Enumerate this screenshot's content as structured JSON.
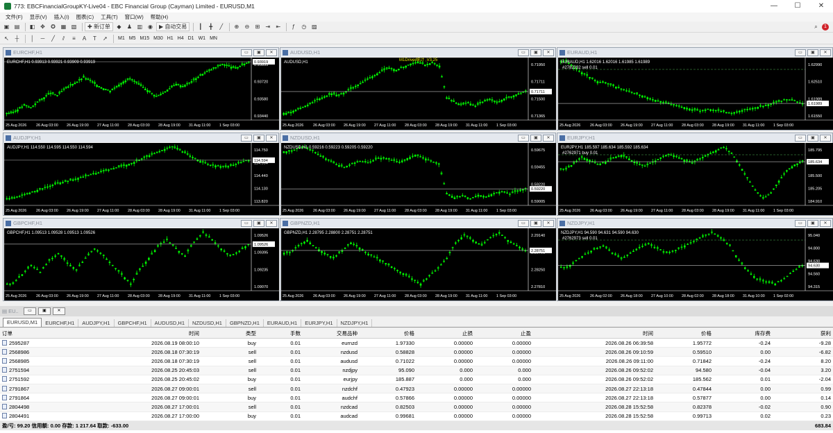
{
  "window": {
    "title": "773: EBCFinancialGroupKY-Live04 - EBC Financial Group (Cayman) Limited - EURUSD,M1",
    "controls": [
      "—",
      "☐",
      "✕"
    ]
  },
  "menu": [
    "文件(F)",
    "显示(V)",
    "插入(I)",
    "图表(C)",
    "工具(T)",
    "窗口(W)",
    "帮助(H)"
  ],
  "toolbar": {
    "new_order": "新订单",
    "auto_trading": "自动交易",
    "timeframes": [
      "M1",
      "M5",
      "M15",
      "M30",
      "H1",
      "H4",
      "D1",
      "W1",
      "MN"
    ],
    "notification_count": "1"
  },
  "colors": {
    "chart_bg": "#000000",
    "bull_candle": "#00ff00",
    "price_line": "#c0c0c0",
    "order_line": "#4caf50"
  },
  "charts": [
    {
      "id": "eurchf",
      "window_title": "EURCHF,H1",
      "header": "EURCHF,H1  0.93913 0.93921 0.93909 0.93919",
      "price_ticks": [
        "0.93855",
        "0.93720",
        "0.93580",
        "0.93440"
      ],
      "current_price": "0.93919",
      "x_ticks": [
        "25 Aug 2026",
        "26 Aug 03:00",
        "26 Aug 19:00",
        "27 Aug 11:00",
        "28 Aug 03:00",
        "28 Aug 19:00",
        "31 Aug 11:00",
        "1 Sep 03:00"
      ],
      "series": [
        0.9346,
        0.9349,
        0.9353,
        0.9351,
        0.9356,
        0.936,
        0.9364,
        0.9362,
        0.9367,
        0.9371,
        0.9374,
        0.9378,
        0.9375,
        0.9371,
        0.9368,
        0.9366,
        0.937,
        0.9374,
        0.9377,
        0.9373,
        0.9369,
        0.9365,
        0.9361,
        0.9364,
        0.9368,
        0.9372,
        0.937,
        0.9373,
        0.9377,
        0.9381,
        0.9384,
        0.9387,
        0.939,
        0.9388,
        0.9386,
        0.9389,
        0.9392
      ],
      "labels": []
    },
    {
      "id": "audusd",
      "window_title": "AUDUSD,H1",
      "header": "AUDUSD,H1",
      "price_ticks": [
        "0.71950",
        "0.71711",
        "0.71500",
        "0.71365"
      ],
      "current_price": "0.71711",
      "x_ticks": [
        "25 Aug 2026",
        "26 Aug 03:00",
        "26 Aug 19:00",
        "27 Aug 11:00",
        "28 Aug 03:00",
        "28 Aug 19:00",
        "31 Aug 11:00",
        "1 Sep 03:00"
      ],
      "series": [
        0.7147,
        0.715,
        0.7153,
        0.7156,
        0.716,
        0.7163,
        0.7166,
        0.7164,
        0.7168,
        0.7172,
        0.7176,
        0.718,
        0.7184,
        0.7188,
        0.7191,
        0.7189,
        0.7192,
        0.7195,
        0.7197,
        0.7194,
        0.7196,
        0.7193,
        0.7162,
        0.7158,
        0.7155,
        0.7157,
        0.7154,
        0.7158,
        0.716,
        0.7157,
        0.7161,
        0.7163,
        0.7166,
        0.7168
      ],
      "labels": [
        "M1Driver统计 ,V3.25"
      ]
    },
    {
      "id": "euraud",
      "window_title": "EURAUD,H1",
      "header": "EURAUD,H1  1.62016 1.62016 1.61985 1.61989",
      "price_ticks": [
        "1.62990",
        "1.62510",
        "1.61989",
        "1.61550"
      ],
      "current_price": "1.61989",
      "x_ticks": [
        "25 Aug 2026",
        "26 Aug 03:00",
        "26 Aug 19:00",
        "27 Aug 11:00",
        "28 Aug 03:00",
        "28 Aug 19:00",
        "31 Aug 11:00",
        "1 Sep 03:00"
      ],
      "series": [
        1.6315,
        1.6298,
        1.6285,
        1.6272,
        1.626,
        1.6255,
        1.6248,
        1.624,
        1.6232,
        1.6225,
        1.6218,
        1.621,
        1.6205,
        1.6198,
        1.6192,
        1.6188,
        1.6182,
        1.6178,
        1.6183,
        1.618,
        1.6176,
        1.6172,
        1.6178,
        1.6183,
        1.6187,
        1.6192,
        1.6198,
        1.6204,
        1.621,
        1.6206,
        1.6199
      ],
      "labels": [
        "#2782332 sell 0.01"
      ]
    },
    {
      "id": "audjpy",
      "window_title": "AUDJPY,H1",
      "header": "AUDJPY,H1  114.550 114.595 114.550 114.594",
      "price_ticks": [
        "114.750",
        "114.594",
        "114.440",
        "114.130",
        "113.820"
      ],
      "current_price": "114.594",
      "x_ticks": [
        "25 Aug 2026",
        "26 Aug 03:00",
        "26 Aug 19:00",
        "27 Aug 11:00",
        "28 Aug 03:00",
        "28 Aug 19:00",
        "31 Aug 11:00",
        "1 Sep 03:00"
      ],
      "series": [
        113.86,
        113.9,
        113.95,
        114.0,
        114.05,
        114.1,
        114.15,
        114.18,
        114.22,
        114.26,
        114.3,
        114.34,
        114.38,
        114.42,
        114.46,
        114.5,
        114.55,
        114.62,
        114.68,
        114.74,
        114.8,
        114.84,
        114.78,
        114.7,
        114.62,
        114.55,
        114.5,
        114.48,
        114.46,
        114.5,
        114.55,
        114.59
      ],
      "labels": []
    },
    {
      "id": "nzdusd",
      "window_title": "NZDUSD,H1",
      "header": "NZDUSD,H1  0.59216 0.59223 0.59205 0.59220",
      "price_ticks": [
        "0.59675",
        "0.59455",
        "0.59220",
        "0.59005"
      ],
      "current_price": "0.59220",
      "x_ticks": [
        "25 Aug 2026",
        "26 Aug 03:00",
        "26 Aug 19:00",
        "27 Aug 11:00",
        "28 Aug 03:00",
        "28 Aug 19:00",
        "31 Aug 11:00",
        "1 Sep 03:00"
      ],
      "series": [
        0.5965,
        0.5968,
        0.597,
        0.5966,
        0.596,
        0.5955,
        0.595,
        0.5947,
        0.5951,
        0.5954,
        0.5952,
        0.5956,
        0.5958,
        0.5955,
        0.5953,
        0.5957,
        0.5961,
        0.5958,
        0.5954,
        0.595,
        0.5917,
        0.5912,
        0.5914,
        0.5911,
        0.5915,
        0.5913,
        0.5917,
        0.5919,
        0.5916,
        0.592,
        0.5922
      ],
      "labels": []
    },
    {
      "id": "eurjpy",
      "window_title": "EURJPY,H1",
      "header": "EURJPY,H1  185.597 185.634 185.592 185.634",
      "price_ticks": [
        "185.795",
        "185.634",
        "185.500",
        "185.205",
        "184.910"
      ],
      "current_price": "185.634",
      "x_ticks": [
        "25 Aug 2026",
        "26 Aug 03:00",
        "26 Aug 19:00",
        "27 Aug 11:00",
        "28 Aug 03:00",
        "28 Aug 19:00",
        "31 Aug 11:00",
        "1 Sep 03:00"
      ],
      "series": [
        185.5,
        185.6,
        185.7,
        185.66,
        185.58,
        185.62,
        185.7,
        185.74,
        185.68,
        185.6,
        185.55,
        185.62,
        185.7,
        185.76,
        185.72,
        185.66,
        185.6,
        185.68,
        185.76,
        185.82,
        185.88,
        185.78,
        185.58,
        185.35,
        185.15,
        185.0,
        185.1,
        185.3,
        185.48,
        185.58,
        185.63
      ],
      "labels": [
        "#2762971 buy 0.01"
      ]
    },
    {
      "id": "gbpchf",
      "window_title": "GBPCHF,H1",
      "header": "GBPCHF,H1  1.09513 1.09528 1.09513 1.09526",
      "price_ticks": [
        "1.09526",
        "1.09395",
        "1.09235",
        "1.09070"
      ],
      "current_price": "1.09526",
      "x_ticks": [
        "25 Aug 2026",
        "26 Aug 03:00",
        "26 Aug 19:00",
        "27 Aug 11:00",
        "28 Aug 03:00",
        "28 Aug 19:00",
        "31 Aug 11:00",
        "1 Sep 03:00"
      ],
      "series": [
        1.0936,
        1.094,
        1.0944,
        1.0941,
        1.0946,
        1.0949,
        1.0945,
        1.0942,
        1.0947,
        1.0951,
        1.0948,
        1.0944,
        1.094,
        1.0936,
        1.0942,
        1.0947,
        1.0952,
        1.0955,
        1.0951,
        1.0948,
        1.0954,
        1.0958,
        1.0955,
        1.0951,
        1.0948,
        1.095,
        1.0953
      ],
      "labels": []
    },
    {
      "id": "gbpnzd",
      "window_title": "GBPNZD,H1",
      "header": "GBPNZD,H1  2.28795 2.28800 2.28751 2.28751",
      "price_ticks": [
        "2.29140",
        "2.28751",
        "2.28250",
        "2.27810"
      ],
      "current_price": "2.28751",
      "x_ticks": [
        "25 Aug 2026",
        "26 Aug 03:00",
        "26 Aug 19:00",
        "27 Aug 11:00",
        "28 Aug 03:00",
        "28 Aug 19:00",
        "31 Aug 11:00",
        "1 Sep 03:00"
      ],
      "series": [
        2.287,
        2.2885,
        2.2895,
        2.288,
        2.287,
        2.286,
        2.2875,
        2.289,
        2.288,
        2.2868,
        2.286,
        2.285,
        2.284,
        2.283,
        2.282,
        2.281,
        2.2825,
        2.284,
        2.286,
        2.289,
        2.2905,
        2.2895,
        2.2885,
        2.29,
        2.291,
        2.2895,
        2.2885,
        2.2875
      ],
      "labels": []
    },
    {
      "id": "nzdjpy",
      "window_title": "NZDJPY,H1",
      "header": "NZDJPY,H1  94.590 94.631 94.590 94.630",
      "price_ticks": [
        "95.040",
        "94.800",
        "94.630",
        "94.560",
        "94.315"
      ],
      "current_price": "94.630",
      "x_ticks": [
        "25 Aug 2026",
        "26 Aug 02:00",
        "26 Aug 18:00",
        "27 Aug 10:00",
        "28 Aug 02:00",
        "28 Aug 18:00",
        "31 Aug 10:00",
        "1 Sep 02:00"
      ],
      "series": [
        94.6,
        94.7,
        94.78,
        94.85,
        94.9,
        94.8,
        94.72,
        94.8,
        94.88,
        94.92,
        94.86,
        94.8,
        94.84,
        94.9,
        94.96,
        95.02,
        95.08,
        95.0,
        94.9,
        94.7,
        94.55,
        94.45,
        94.4,
        94.38,
        94.45,
        94.55,
        94.63
      ],
      "labels": [
        "#2762973 sell 0.01"
      ]
    }
  ],
  "terminal": {
    "tabs": [
      "EURUSD,M1",
      "EURCHF,H1",
      "AUDJPY,H1",
      "GBPCHF,H1",
      "AUDUSD,H1",
      "NZDUSD,H1",
      "GBPNZD,H1",
      "EURAUD,H1",
      "EURJPY,H1",
      "NZDJPY,H1"
    ],
    "columns": [
      "订单",
      "时间",
      "类型",
      "手数",
      "交易品种",
      "价格",
      "止损",
      "止盈",
      "时间",
      "价格",
      "库存费",
      "获利"
    ],
    "rows": [
      [
        "2595287",
        "2026.08.19 08:00:10",
        "buy",
        "0.01",
        "eurnzd",
        "1.97330",
        "0.00000",
        "0.00000",
        "2026.08.26 06:39:58",
        "1.95772",
        "-0.24",
        "-9.28"
      ],
      [
        "2568986",
        "2026.08.18 07:30:19",
        "sell",
        "0.01",
        "nzdusd",
        "0.58828",
        "0.00000",
        "0.00000",
        "2026.08.26 09:10:59",
        "0.59510",
        "0.00",
        "-6.82"
      ],
      [
        "2568985",
        "2026.08.18 07:30:19",
        "sell",
        "0.01",
        "audusd",
        "0.71022",
        "0.00000",
        "0.00000",
        "2026.08.26 09:11:00",
        "0.71842",
        "-0.24",
        "8.20"
      ],
      [
        "2751594",
        "2026.08.25 20:45:03",
        "sell",
        "0.01",
        "nzdjpy",
        "95.090",
        "0.000",
        "0.000",
        "2026.08.26 09:52:02",
        "94.580",
        "-0.04",
        "3.20"
      ],
      [
        "2751592",
        "2026.08.25 20:45:02",
        "buy",
        "0.01",
        "eurjpy",
        "185.887",
        "0.000",
        "0.000",
        "2026.08.26 09:52:02",
        "185.562",
        "0.01",
        "-2.04"
      ],
      [
        "2791867",
        "2026.08.27 09:00:01",
        "sell",
        "0.01",
        "nzdchf",
        "0.47923",
        "0.00000",
        "0.00000",
        "2026.08.27 22:13:18",
        "0.47844",
        "0.00",
        "0.99"
      ],
      [
        "2791864",
        "2026.08.27 09:00:01",
        "buy",
        "0.01",
        "audchf",
        "0.57866",
        "0.00000",
        "0.00000",
        "2026.08.27 22:13:18",
        "0.57877",
        "0.00",
        "0.14"
      ],
      [
        "2804498",
        "2026.08.27 17:00:01",
        "sell",
        "0.01",
        "nzdcad",
        "0.82503",
        "0.00000",
        "0.00000",
        "2026.08.28 15:52:58",
        "0.82378",
        "-0.02",
        "0.90"
      ],
      [
        "2804491",
        "2026.08.27 17:00:00",
        "buy",
        "0.01",
        "audcad",
        "0.99681",
        "0.00000",
        "0.00000",
        "2026.08.28 15:52:58",
        "0.99713",
        "0.02",
        "0.23"
      ]
    ],
    "summary": "盈/亏: 99.20  信用额: 0.00  存款: 1 217.64  取款: -633.00",
    "summary_total": "683.84"
  }
}
